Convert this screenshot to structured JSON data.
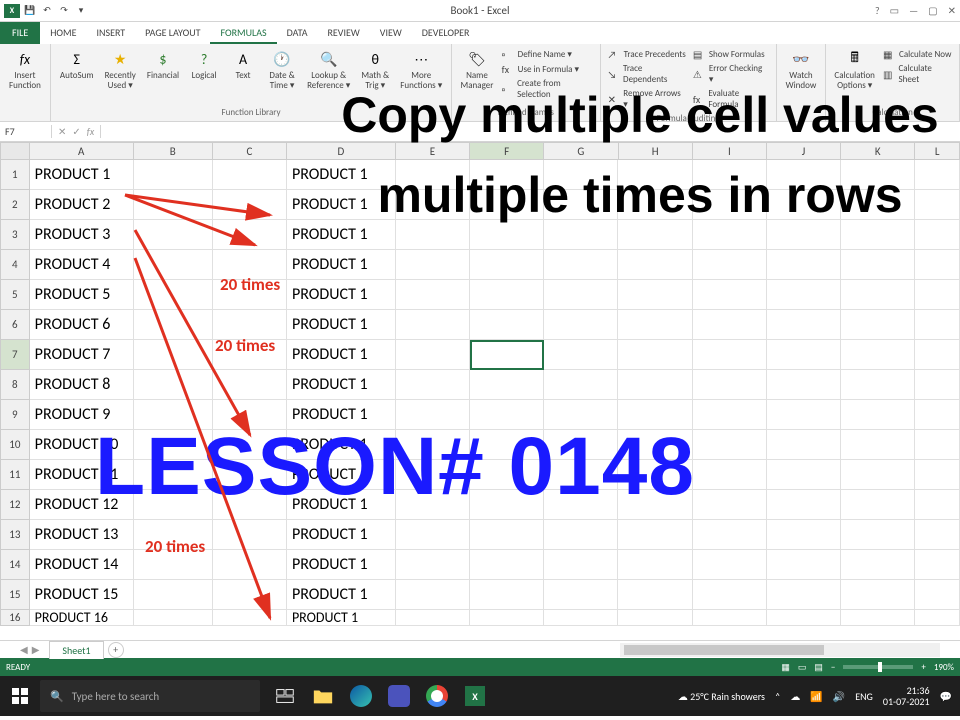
{
  "titlebar": {
    "title": "Book1 - Excel"
  },
  "tabs": {
    "file": "FILE",
    "home": "HOME",
    "insert": "INSERT",
    "page_layout": "PAGE LAYOUT",
    "formulas": "FORMULAS",
    "data": "DATA",
    "review": "REVIEW",
    "view": "VIEW",
    "developer": "DEVELOPER"
  },
  "ribbon": {
    "insert_function": "Insert\nFunction",
    "autosum": "AutoSum",
    "recently_used": "Recently\nUsed ▾",
    "financial": "Financial",
    "logical": "Logical",
    "text": "Text",
    "date_time": "Date &\nTime ▾",
    "lookup": "Lookup &\nReference ▾",
    "math_trig": "Math &\nTrig ▾",
    "more_functions": "More\nFunctions ▾",
    "function_library": "Function Library",
    "name_manager": "Name\nManager",
    "define_name": "Define Name ▾",
    "use_in_formula": "Use in Formula ▾",
    "create_from_selection": "Create from Selection",
    "defined_names": "Defined Names",
    "trace_precedents": "Trace Precedents",
    "trace_dependents": "Trace Dependents",
    "remove_arrows": "Remove Arrows ▾",
    "show_formulas": "Show Formulas",
    "error_checking": "Error Checking ▾",
    "evaluate_formula": "Evaluate Formula",
    "formula_auditing": "Formula Auditing",
    "watch_window": "Watch\nWindow",
    "calculation_options": "Calculation\nOptions ▾",
    "calculate_now": "Calculate Now",
    "calculate_sheet": "Calculate Sheet",
    "calculation": "Calculation"
  },
  "name_box": "F7",
  "columns": [
    "A",
    "B",
    "C",
    "D",
    "E",
    "F",
    "G",
    "H",
    "I",
    "J",
    "K",
    "L"
  ],
  "active_col": "F",
  "active_row": 7,
  "cells_a": [
    "PRODUCT 1",
    "PRODUCT 2",
    "PRODUCT 3",
    "PRODUCT 4",
    "PRODUCT 5",
    "PRODUCT 6",
    "PRODUCT 7",
    "PRODUCT 8",
    "PRODUCT 9",
    "PRODUCT 10",
    "PRODUCT 11",
    "PRODUCT 12",
    "PRODUCT 13",
    "PRODUCT 14",
    "PRODUCT 15",
    "PRODUCT 16"
  ],
  "cells_d": [
    "PRODUCT 1",
    "PRODUCT 1",
    "PRODUCT 1",
    "PRODUCT 1",
    "PRODUCT 1",
    "PRODUCT 1",
    "PRODUCT 1",
    "PRODUCT 1",
    "PRODUCT 1",
    "PRODUCT 1",
    "PRODUCT 1",
    "PRODUCT 1",
    "PRODUCT 1",
    "PRODUCT 1",
    "PRODUCT 1",
    "PRODUCT 1"
  ],
  "sheet": {
    "name": "Sheet1"
  },
  "statusbar": {
    "ready": "READY",
    "zoom": "190%"
  },
  "taskbar": {
    "search_placeholder": "Type here to search",
    "weather": "25°C Rain showers",
    "lang": "ENG",
    "time": "21:36",
    "date": "01-07-2021"
  },
  "overlay": {
    "black": "Copy multiple cell values multiple times in rows",
    "blue": "LESSON# 0148",
    "red1": "20 times",
    "red2": "20 times",
    "red3": "20 times"
  }
}
